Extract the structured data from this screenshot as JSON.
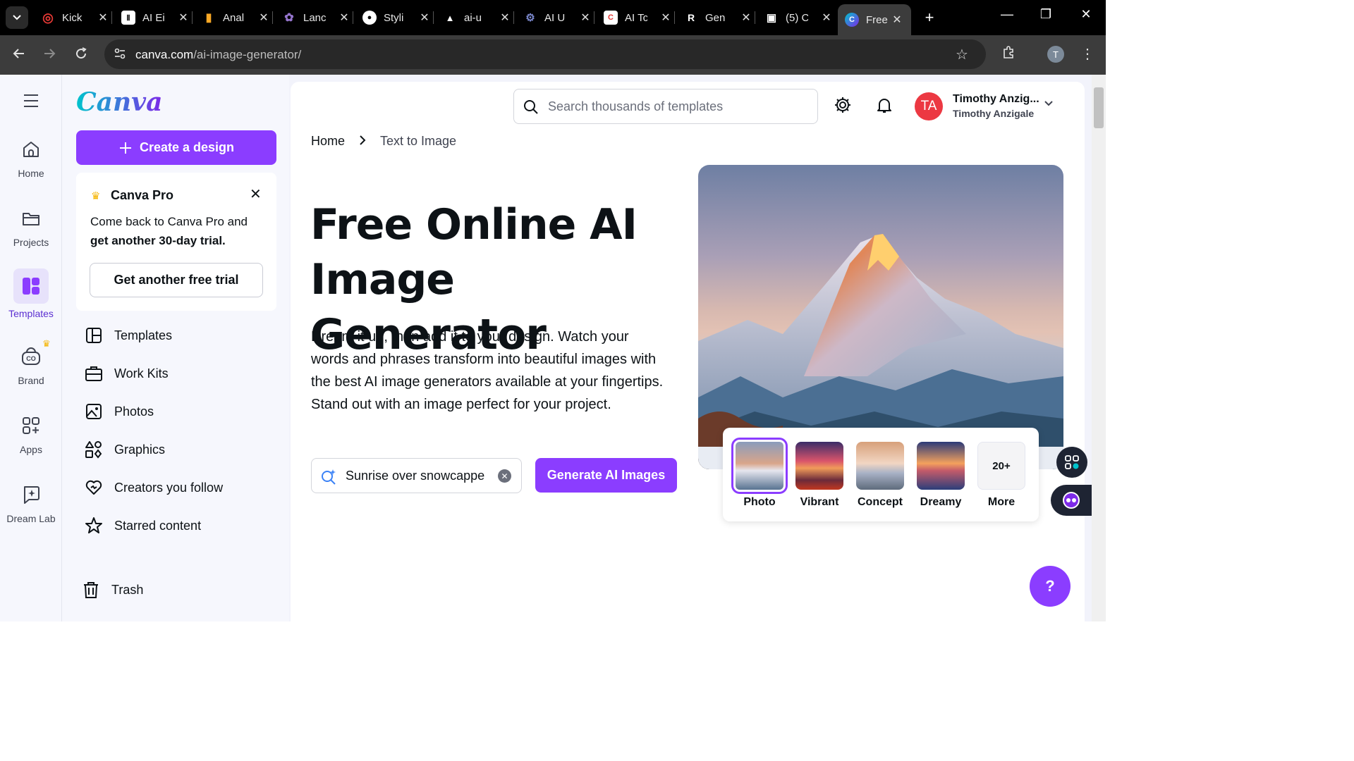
{
  "browser": {
    "tabs": [
      {
        "title": "Kick",
        "fav_color": "#e53935",
        "fav_glyph": "◎"
      },
      {
        "title": "AI Ei",
        "fav_color": "#ffffff",
        "fav_glyph": "Ⅱ"
      },
      {
        "title": "Anal",
        "fav_color": "#f9a825",
        "fav_glyph": "▮"
      },
      {
        "title": "Lanc",
        "fav_color": "#7e57c2",
        "fav_glyph": "✿"
      },
      {
        "title": "Styli",
        "fav_color": "#ffffff",
        "fav_glyph": "●"
      },
      {
        "title": "ai-u",
        "fav_color": "#000000",
        "fav_glyph": "▲"
      },
      {
        "title": "AI U",
        "fav_color": "#5c6bc0",
        "fav_glyph": "⚙"
      },
      {
        "title": "AI Tc",
        "fav_color": "#ffffff",
        "fav_glyph": "C"
      },
      {
        "title": "Gen",
        "fav_color": "#000000",
        "fav_glyph": "R"
      },
      {
        "title": "(5) C",
        "fav_color": "#000000",
        "fav_glyph": "▣"
      },
      {
        "title": "Free",
        "fav_color": "#00c4cc",
        "fav_glyph": "C",
        "active": true
      }
    ],
    "url_host": "canva.com",
    "url_path": "/ai-image-generator/",
    "profile_initial": "T"
  },
  "rail": {
    "items": [
      {
        "label": "Home",
        "icon": "home-icon"
      },
      {
        "label": "Projects",
        "icon": "folder-icon"
      },
      {
        "label": "Templates",
        "icon": "templates-icon",
        "active": true
      },
      {
        "label": "Brand",
        "icon": "brand-icon"
      },
      {
        "label": "Apps",
        "icon": "apps-icon"
      },
      {
        "label": "Dream Lab",
        "icon": "dream-lab-icon"
      }
    ]
  },
  "panel": {
    "logo": "Canva",
    "create_label": "Create a design",
    "promo": {
      "title": "Canva Pro",
      "text_plain": "Come back to Canva Pro and",
      "text_bold": "get another 30-day trial.",
      "button": "Get another free trial"
    },
    "nav": [
      {
        "label": "Templates",
        "icon": "template-layout-icon"
      },
      {
        "label": "Work Kits",
        "icon": "briefcase-icon"
      },
      {
        "label": "Photos",
        "icon": "image-icon"
      },
      {
        "label": "Graphics",
        "icon": "shapes-icon"
      },
      {
        "label": "Creators you follow",
        "icon": "heart-icon"
      },
      {
        "label": "Starred content",
        "icon": "star-icon"
      },
      {
        "label": "Trash",
        "icon": "trash-icon"
      }
    ]
  },
  "header": {
    "search_placeholder": "Search thousands of templates",
    "user_initials": "TA",
    "user_name": "Timothy Anzig...",
    "user_team": "Timothy Anzigale"
  },
  "breadcrumb": {
    "home": "Home",
    "separator": ">",
    "current": "Text to Image"
  },
  "hero": {
    "title": "Free Online AI Image Generator",
    "description": "Dream it up, then add it to your design. Watch your words and phrases transform into beautiful images with the best AI image generators available at your fingertips. Stand out with an image perfect for your project.",
    "prompt_value": "Sunrise over snowcappe",
    "generate_label": "Generate AI Images"
  },
  "styles": [
    {
      "label": "Photo",
      "selected": true
    },
    {
      "label": "Vibrant"
    },
    {
      "label": "Concept"
    },
    {
      "label": "Dreamy"
    },
    {
      "label": "More",
      "badge": "20+"
    }
  ],
  "help_label": "?"
}
